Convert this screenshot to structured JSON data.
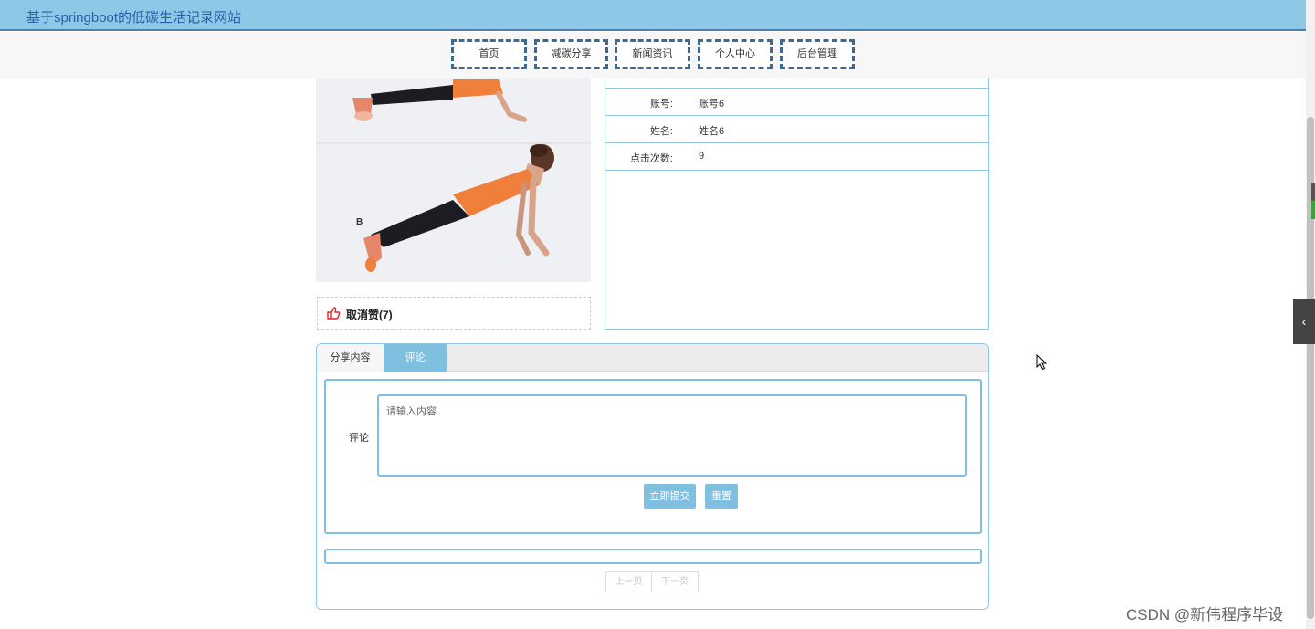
{
  "header": {
    "title": "基于springboot的低碳生活记录网站"
  },
  "nav": [
    "首页",
    "减碳分享",
    "新闻资讯",
    "个人中心",
    "后台管理"
  ],
  "like": {
    "label": "取消赞(7)",
    "icon": "thumbs-up-icon",
    "icon_color": "#e0262b"
  },
  "info_rows": [
    {
      "label": "账号:",
      "value": "账号6"
    },
    {
      "label": "姓名:",
      "value": "姓名6"
    },
    {
      "label": "点击次数:",
      "value": "9"
    }
  ],
  "photo": {
    "letter": "B"
  },
  "tabs": [
    "分享内容",
    "评论"
  ],
  "comment_form": {
    "label": "评论",
    "placeholder": "请输入内容",
    "submit_label": "立即提交",
    "reset_label": "重置"
  },
  "pager": {
    "prev": "上一页",
    "next": "下一页"
  },
  "side_toggle": {
    "glyph": "‹"
  },
  "watermark": "CSDN @新伟程序毕设",
  "colors": {
    "accent": "#7fbfe0",
    "header_bg": "#8ec8e6",
    "nav_border": "#3c6a96"
  }
}
